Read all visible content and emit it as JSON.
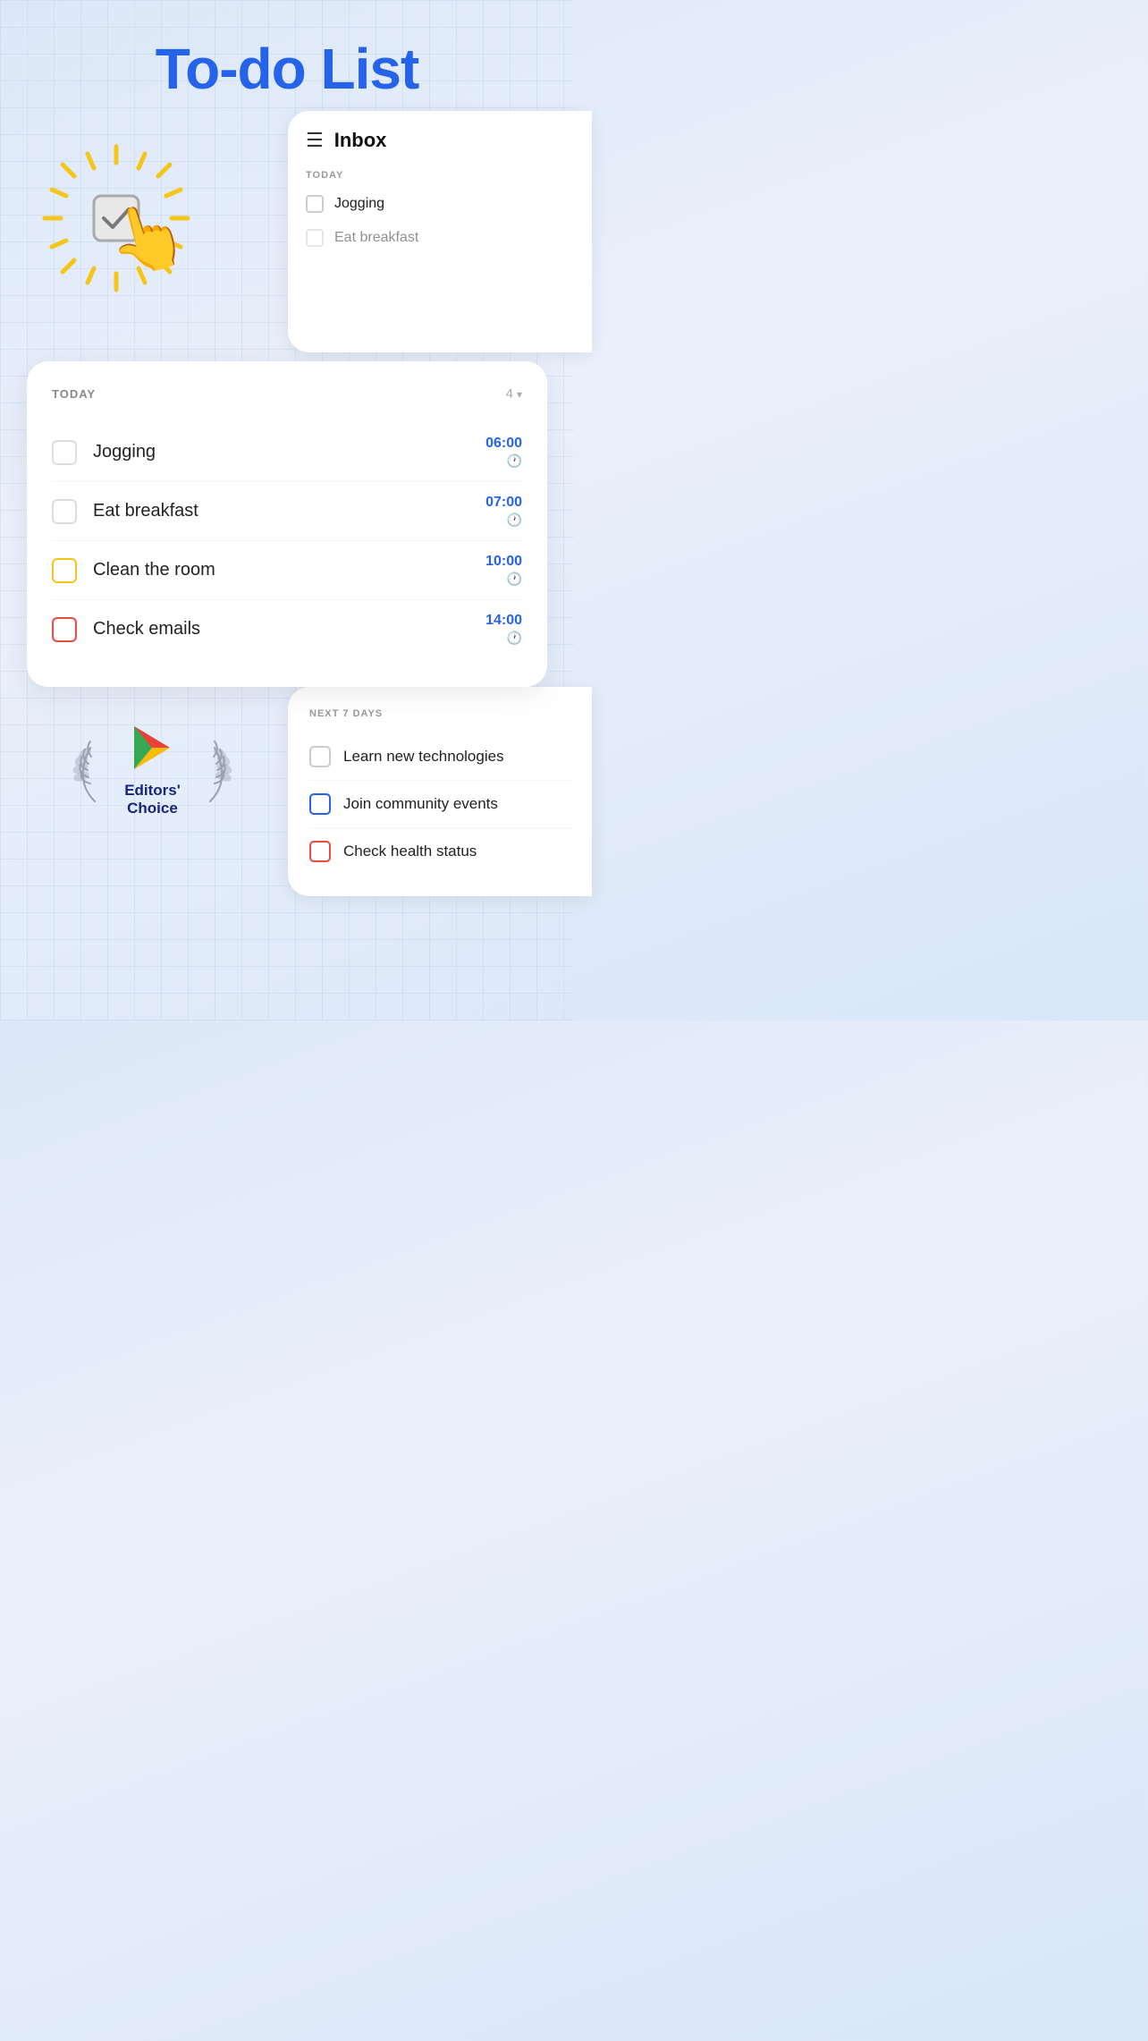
{
  "app": {
    "title": "To-do List"
  },
  "inbox": {
    "title": "Inbox",
    "section_today": "TODAY",
    "items": [
      {
        "name": "Jogging",
        "checked": false
      },
      {
        "name": "Eat breakfast",
        "checked": false
      }
    ]
  },
  "today": {
    "label": "TODAY",
    "count": "4",
    "tasks": [
      {
        "name": "Jogging",
        "time": "06:00",
        "checkbox_type": "default"
      },
      {
        "name": "Eat breakfast",
        "time": "07:00",
        "checkbox_type": "default"
      },
      {
        "name": "Clean the room",
        "time": "10:00",
        "checkbox_type": "yellow"
      },
      {
        "name": "Check emails",
        "time": "14:00",
        "checkbox_type": "red"
      }
    ]
  },
  "next7": {
    "label": "NEXT 7 DAYS",
    "items": [
      {
        "name": "Learn new technologies",
        "checkbox_type": "default"
      },
      {
        "name": "Join community events",
        "checkbox_type": "blue"
      },
      {
        "name": "Check health status",
        "checkbox_type": "red"
      }
    ]
  },
  "editors_choice": {
    "label": "Editors'\nChoice"
  }
}
